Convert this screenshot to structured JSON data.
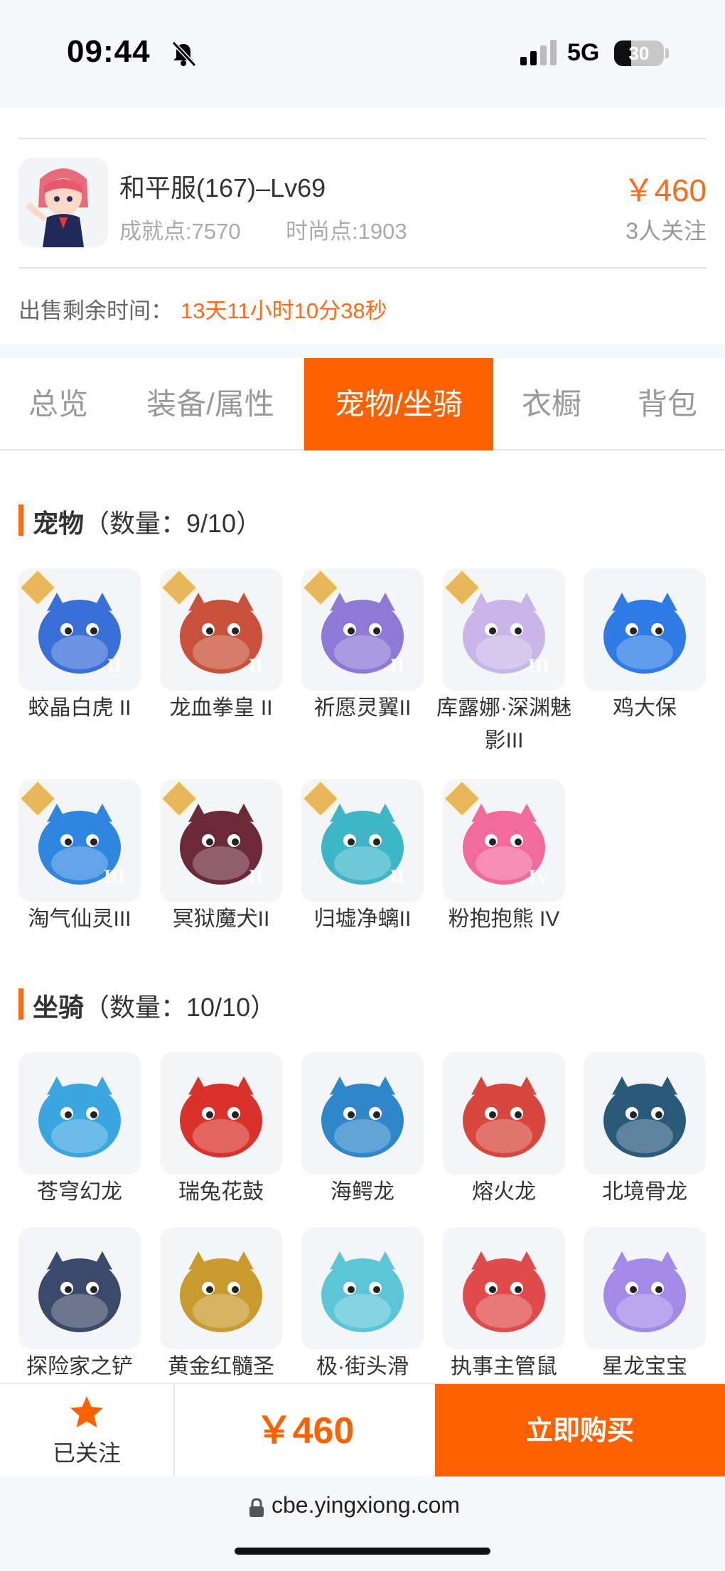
{
  "status_bar": {
    "time": "09:44",
    "network": "5G",
    "battery": "30"
  },
  "product": {
    "title": "和平服(167)–Lv69",
    "achievement": "成就点:7570",
    "fashion": "时尚点:1903",
    "price": "￥460",
    "followers": "3人关注",
    "remaining_label": "出售剩余时间：",
    "remaining_value": "13天11小时10分38秒"
  },
  "tabs": [
    {
      "label": "总览",
      "active": false
    },
    {
      "label": "装备/属性",
      "active": false
    },
    {
      "label": "宠物/坐骑",
      "active": true
    },
    {
      "label": "衣橱",
      "active": false
    },
    {
      "label": "背包",
      "active": false
    }
  ],
  "pets_section": {
    "title": "宠物",
    "count": "（数量：9/10）"
  },
  "pets": [
    {
      "name": "蛟晶白虎 II",
      "badge": "II",
      "icon": "white-tiger-icon",
      "color": "#3a6fd8"
    },
    {
      "name": "龙血拳皇 II",
      "badge": "II",
      "icon": "dragon-boxer-icon",
      "color": "#c9503a"
    },
    {
      "name": "祈愿灵翼II",
      "badge": "II",
      "icon": "griffin-icon",
      "color": "#8e7ad6"
    },
    {
      "name": "库露娜·深渊魅影III",
      "badge": "III",
      "icon": "abyss-girl-icon",
      "color": "#c9b6e8"
    },
    {
      "name": "鸡大保",
      "badge": "",
      "icon": "blue-chick-icon",
      "color": "#2f7be6"
    },
    {
      "name": "淘气仙灵III",
      "badge": "III",
      "icon": "blue-puppy-icon",
      "color": "#2f86e0"
    },
    {
      "name": "冥狱魔犬II",
      "badge": "II",
      "icon": "hell-hound-icon",
      "color": "#6a2a3a"
    },
    {
      "name": "归墟净螭II",
      "badge": "II",
      "icon": "water-dragon-icon",
      "color": "#3fb6c8"
    },
    {
      "name": "粉抱抱熊 IV",
      "badge": "IV",
      "icon": "pink-bear-icon",
      "color": "#f06a9a"
    }
  ],
  "mounts_section": {
    "title": "坐骑",
    "count": "（数量：10/10）"
  },
  "mounts": [
    {
      "name": "苍穹幻龙",
      "icon": "sky-dragon-icon",
      "color": "#3aa6e0"
    },
    {
      "name": "瑞兔花鼓",
      "icon": "rabbit-drum-icon",
      "color": "#d9322a"
    },
    {
      "name": "海鳄龙",
      "icon": "sea-croc-dragon-icon",
      "color": "#2f86c8"
    },
    {
      "name": "熔火龙",
      "icon": "magma-dragon-icon",
      "color": "#d8463e"
    },
    {
      "name": "北境骨龙",
      "icon": "bone-dragon-icon",
      "color": "#2a5a7a"
    },
    {
      "name": "探险家之铲",
      "icon": "shovel-icon",
      "color": "#3b4a6a"
    },
    {
      "name": "黄金红髓圣",
      "icon": "golden-mask-icon",
      "color": "#c99a2e"
    },
    {
      "name": "极·街头滑",
      "icon": "skateboard-icon",
      "color": "#5cc6d8"
    },
    {
      "name": "执事主管鼠",
      "icon": "butler-mouse-icon",
      "color": "#e04a4a"
    },
    {
      "name": "星龙宝宝",
      "icon": "star-dragon-baby-icon",
      "color": "#a48ae8"
    }
  ],
  "bottom_bar": {
    "follow_label": "已关注",
    "price": "￥460",
    "buy_label": "立即购买"
  },
  "browser": {
    "url": "cbe.yingxiong.com"
  }
}
